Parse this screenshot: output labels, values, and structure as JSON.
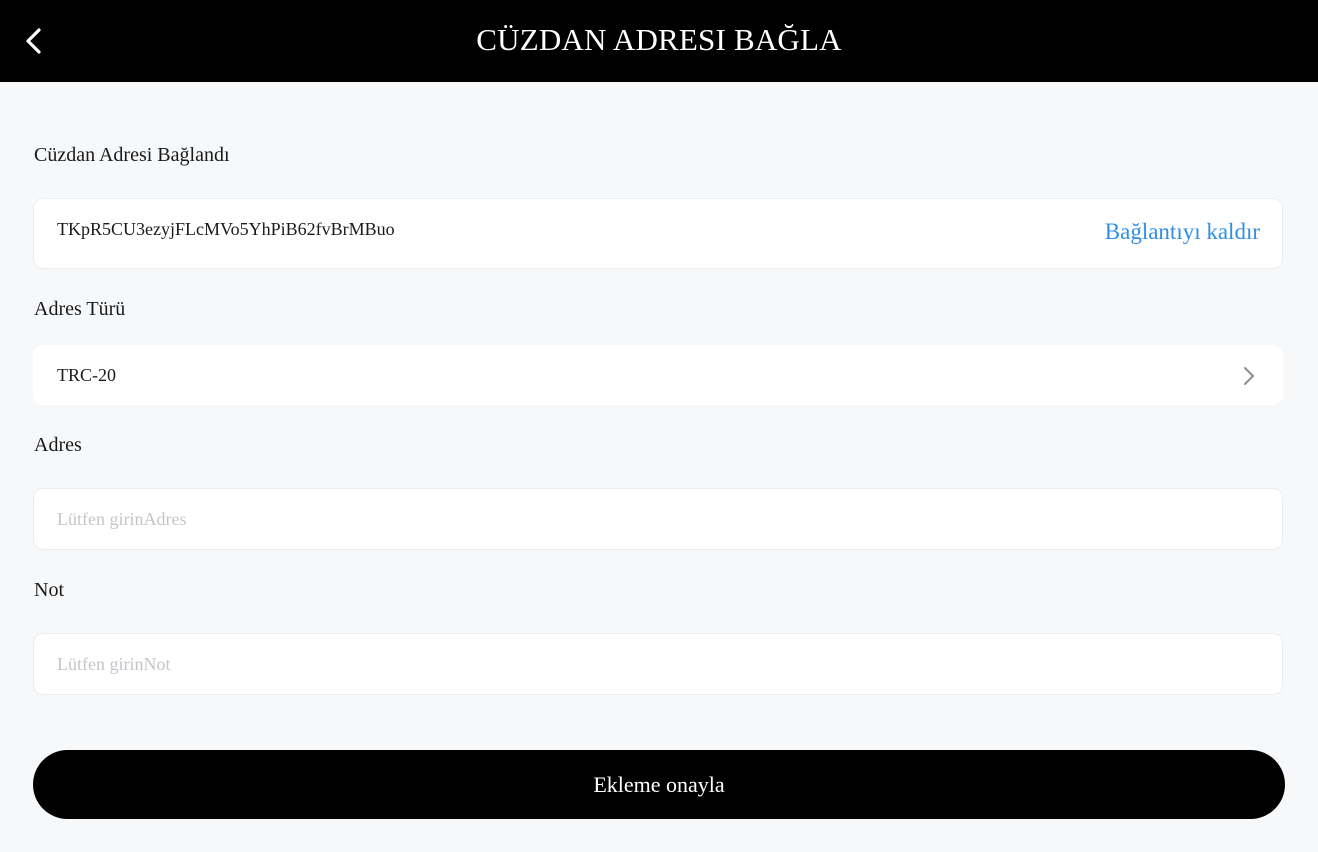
{
  "header": {
    "title": "CÜZDAN ADRESI BAĞLA",
    "back_icon": "chevron-left-icon"
  },
  "bound_section": {
    "label": "Cüzdan Adresi Bağlandı",
    "address": "TKpR5CU3ezyjFLcMVo5YhPiB62fvBrMBuo",
    "unbind_label": "Bağlantıyı kaldır",
    "unbind_color": "#2f8fe6"
  },
  "address_type": {
    "label": "Adres Türü",
    "value": "TRC-20",
    "icon": "chevron-right-icon"
  },
  "address": {
    "label": "Adres",
    "placeholder": "Lütfen girinAdres",
    "value": ""
  },
  "note": {
    "label": "Not",
    "placeholder": "Lütfen girinNot",
    "value": ""
  },
  "confirm": {
    "label": "Ekleme onayla"
  },
  "colors": {
    "header_bg": "#000000",
    "page_bg": "#f7f8fa",
    "button_bg": "#000000",
    "placeholder": "#c4c6cb"
  }
}
